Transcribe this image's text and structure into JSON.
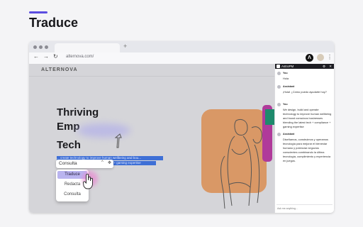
{
  "heading": "Traduce",
  "colors": {
    "accent": "#5b4de0",
    "selection": "#3e6fd6",
    "menu_active": "#b9b4ef",
    "art_orange": "#d99866",
    "art_magenta": "#b03a9a",
    "art_green": "#1e8a6c"
  },
  "browser": {
    "new_tab_label": "+",
    "url": "alternova.com/",
    "nav": {
      "back": "←",
      "forward": "→",
      "reload": "↻"
    },
    "extension_logo": "Λ",
    "menu_icon": "⋮"
  },
  "site": {
    "logo": "ALTERNOVA",
    "hero_lines": [
      "Thriving",
      "Emp",
      "Tech"
    ],
    "selected_text": [
      "... create technology to improve human wellbeing and bou...",
      "... blending the latest tech + compliance + gaming expertise"
    ]
  },
  "popup": {
    "selected_option": "Consulta",
    "caret": "^",
    "move_icon": "✥",
    "options": [
      "Traduce",
      "Redacta",
      "Consulta"
    ],
    "active_option": "Traduce"
  },
  "panel": {
    "title": "AstroPM",
    "controls": "⚙ ✕",
    "messages": [
      {
        "role": "You",
        "text": "Hola"
      },
      {
        "role": "Assistant",
        "text": "¡Hola! ¿Cómo puedo ayudarte hoy?"
      },
      {
        "role": "You",
        "text": "We design, build and operate technology to improve human wellbeing and boost conscious businesses blending the latest tech + compliance + gaming expertise"
      },
      {
        "role": "Assistant",
        "text": "Diseñamos, construimos y operamos tecnología para mejorar el bienestar humano y potenciar negocios conscientes combinando la última tecnología, cumplimiento y experiencia en juegos."
      }
    ],
    "input_placeholder": "Ask me anything..."
  }
}
